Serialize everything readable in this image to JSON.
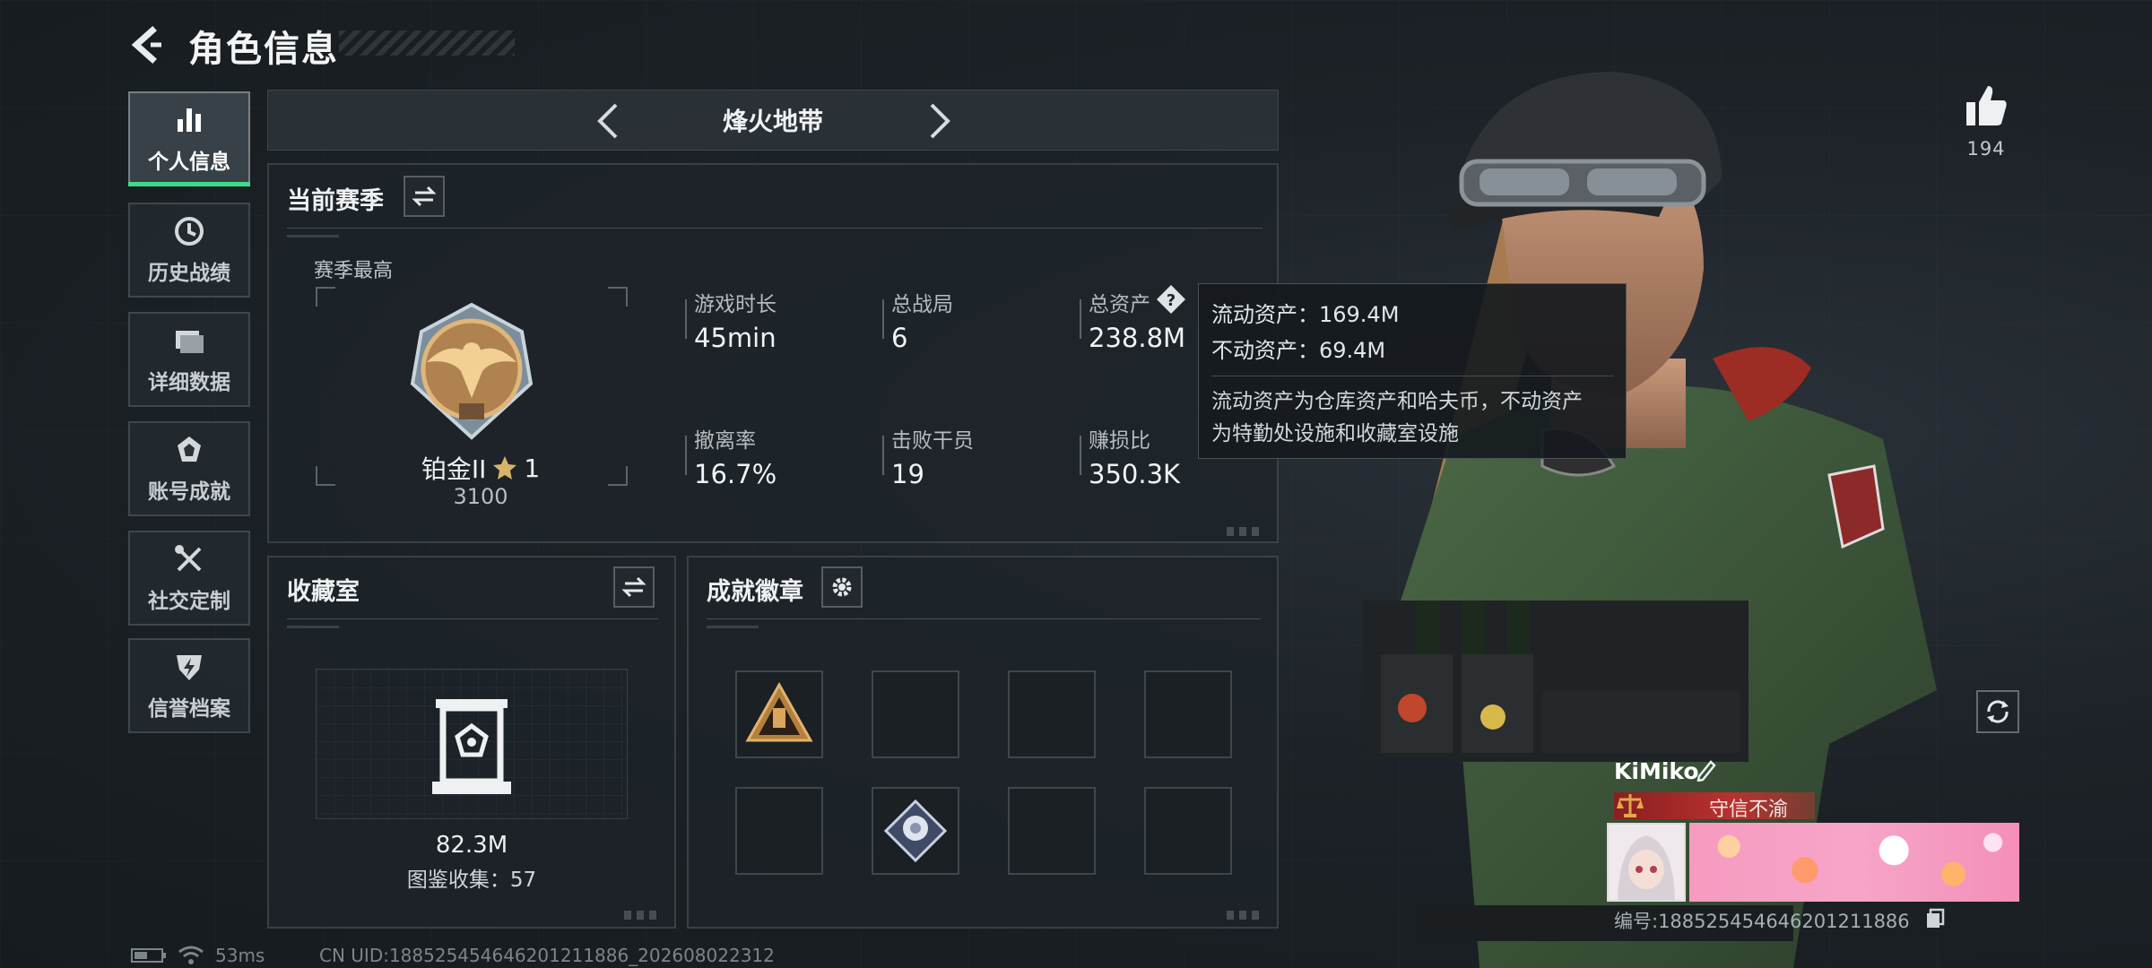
{
  "header": {
    "title": "角色信息"
  },
  "sidebar": {
    "items": [
      {
        "label": "个人信息",
        "icon": "bar-chart-icon"
      },
      {
        "label": "历史战绩",
        "icon": "clock-icon"
      },
      {
        "label": "详细数据",
        "icon": "folder-icon"
      },
      {
        "label": "账号成就",
        "icon": "medal-icon"
      },
      {
        "label": "社交定制",
        "icon": "tools-icon"
      },
      {
        "label": "信誉档案",
        "icon": "shield-bolt-icon"
      }
    ],
    "active_index": 0
  },
  "map": {
    "title": "烽火地带"
  },
  "season": {
    "title": "当前赛季",
    "best_label": "赛季最高",
    "rank_name": "铂金II",
    "rank_stars": "1",
    "rank_points": "3100",
    "stats": [
      {
        "label": "游戏时长",
        "value": "45min"
      },
      {
        "label": "总战局",
        "value": "6"
      },
      {
        "label": "总资产",
        "value": "238.8M"
      },
      {
        "label": "撤离率",
        "value": "16.7%"
      },
      {
        "label": "击败干员",
        "value": "19"
      },
      {
        "label": "赚损比",
        "value": "350.3K"
      }
    ]
  },
  "tooltip": {
    "liquid": "流动资产：169.4M",
    "fixed": "不动资产：69.4M",
    "desc_line1": "流动资产为仓库资产和哈夫币，不动资产",
    "desc_line2": "为特勤处设施和收藏室设施"
  },
  "collection": {
    "title": "收藏室",
    "value": "82.3M",
    "codex": "图鉴收集：57"
  },
  "achievements": {
    "title": "成就徽章"
  },
  "likes": {
    "count": "194"
  },
  "player": {
    "name": "KiMiko",
    "title": "守信不渝",
    "id_line": "编号:1885254546462012118​86"
  },
  "status": {
    "ping": "53ms",
    "cn_uid": "CN UID:18852545464620121188​6_202608022312"
  },
  "colors": {
    "accent": "#3fd98a",
    "title_banner": "#b83230",
    "panel_bg": "#1e2429"
  }
}
